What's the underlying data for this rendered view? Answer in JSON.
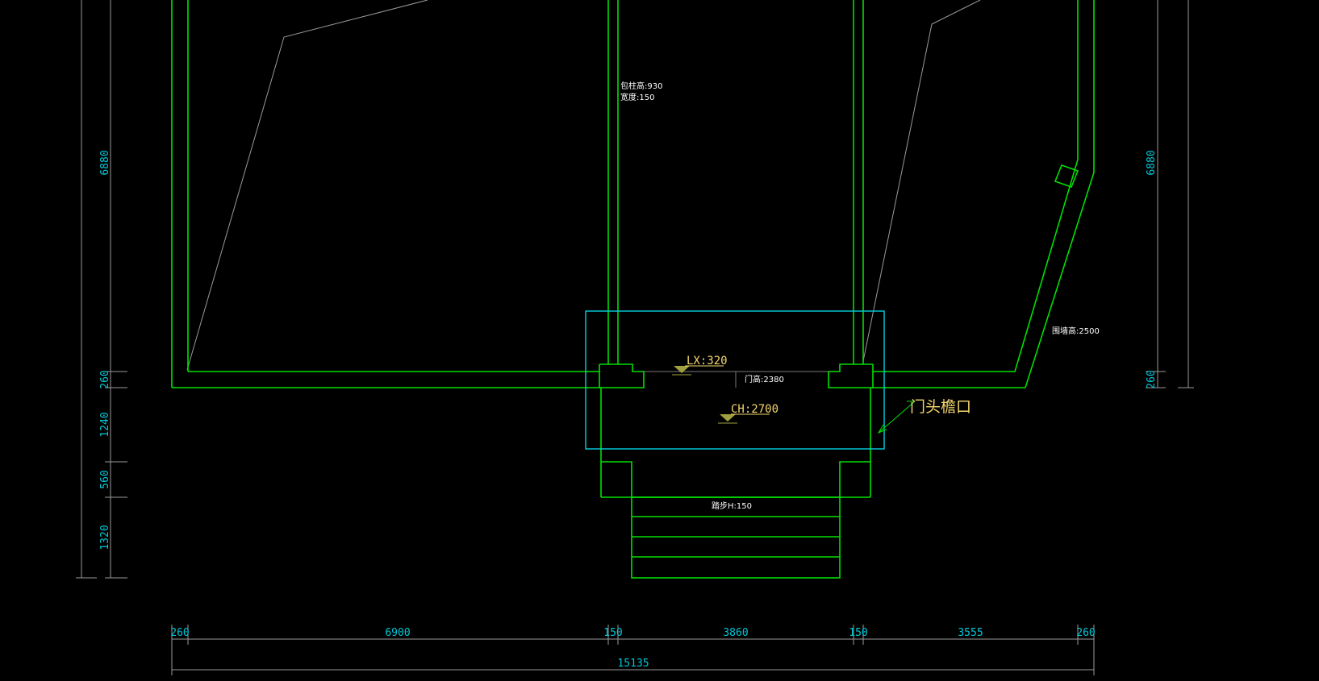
{
  "drawing": {
    "colors": {
      "background": "#000000",
      "wall": "#00e000",
      "dimension": "#00c8d8",
      "leader": "#9a9a9a",
      "elevation": "#f5d76e",
      "annotation": "#ffffff"
    },
    "vertical_dims_left": [
      "6880",
      "260",
      "1240",
      "560",
      "1320"
    ],
    "vertical_dims_right": [
      "6880",
      "260"
    ],
    "bottom_dims": [
      "260",
      "6900",
      "150",
      "3860",
      "150",
      "3555",
      "260"
    ],
    "total_dim": "15135",
    "labels": {
      "column_note_1": "包柱高:930",
      "column_note_2": "宽度:150",
      "wall_height": "围墙高:2500",
      "door_height": "门高:2380",
      "step_height": "踏步H:150",
      "lintel": "LX:320",
      "canopy_height": "CH:2700",
      "callout": "门头檐口"
    }
  }
}
